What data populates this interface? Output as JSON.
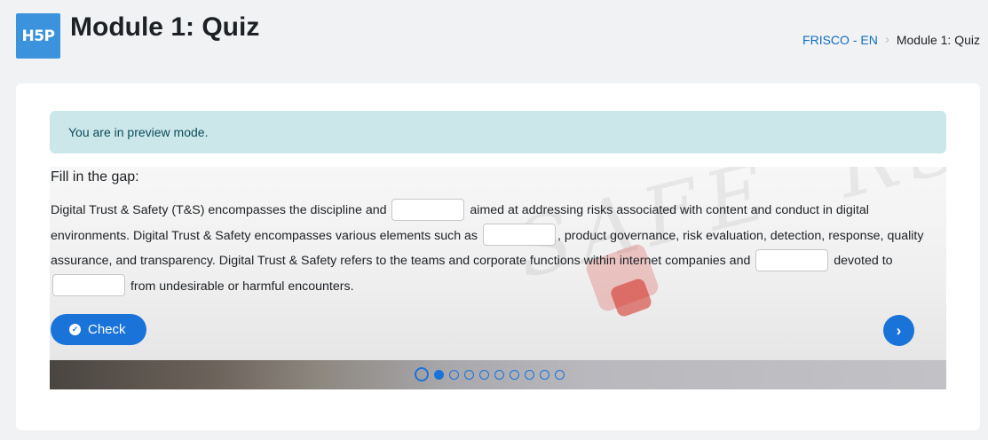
{
  "header": {
    "logo_text": "H5P",
    "title": "Module 1: Quiz",
    "breadcrumb": [
      {
        "label": "FRISCO - EN"
      },
      {
        "label": "Module 1: Quiz"
      }
    ]
  },
  "alert": {
    "text": "You are in preview mode."
  },
  "quiz": {
    "title": "Fill in the gap:",
    "segments": [
      "Digital Trust & Safety (T&S) encompasses the discipline and",
      "aimed at addressing risks associated with content and conduct in digital environments. Digital Trust & Safety encompasses various elements such as",
      ", product governance, risk evaluation, detection, response, quality assurance, and transparency. Digital Trust & Safety refers to the teams and corporate functions within internet companies and",
      "devoted to",
      "from undesirable or harmful encounters."
    ],
    "check_label": "Check",
    "dots_total": 10,
    "active_dot": 1
  },
  "colors": {
    "accent": "#1a73d9",
    "alert_bg": "#cce7ea",
    "alert_text": "#0c4d5a",
    "link": "#0f6cbf"
  }
}
